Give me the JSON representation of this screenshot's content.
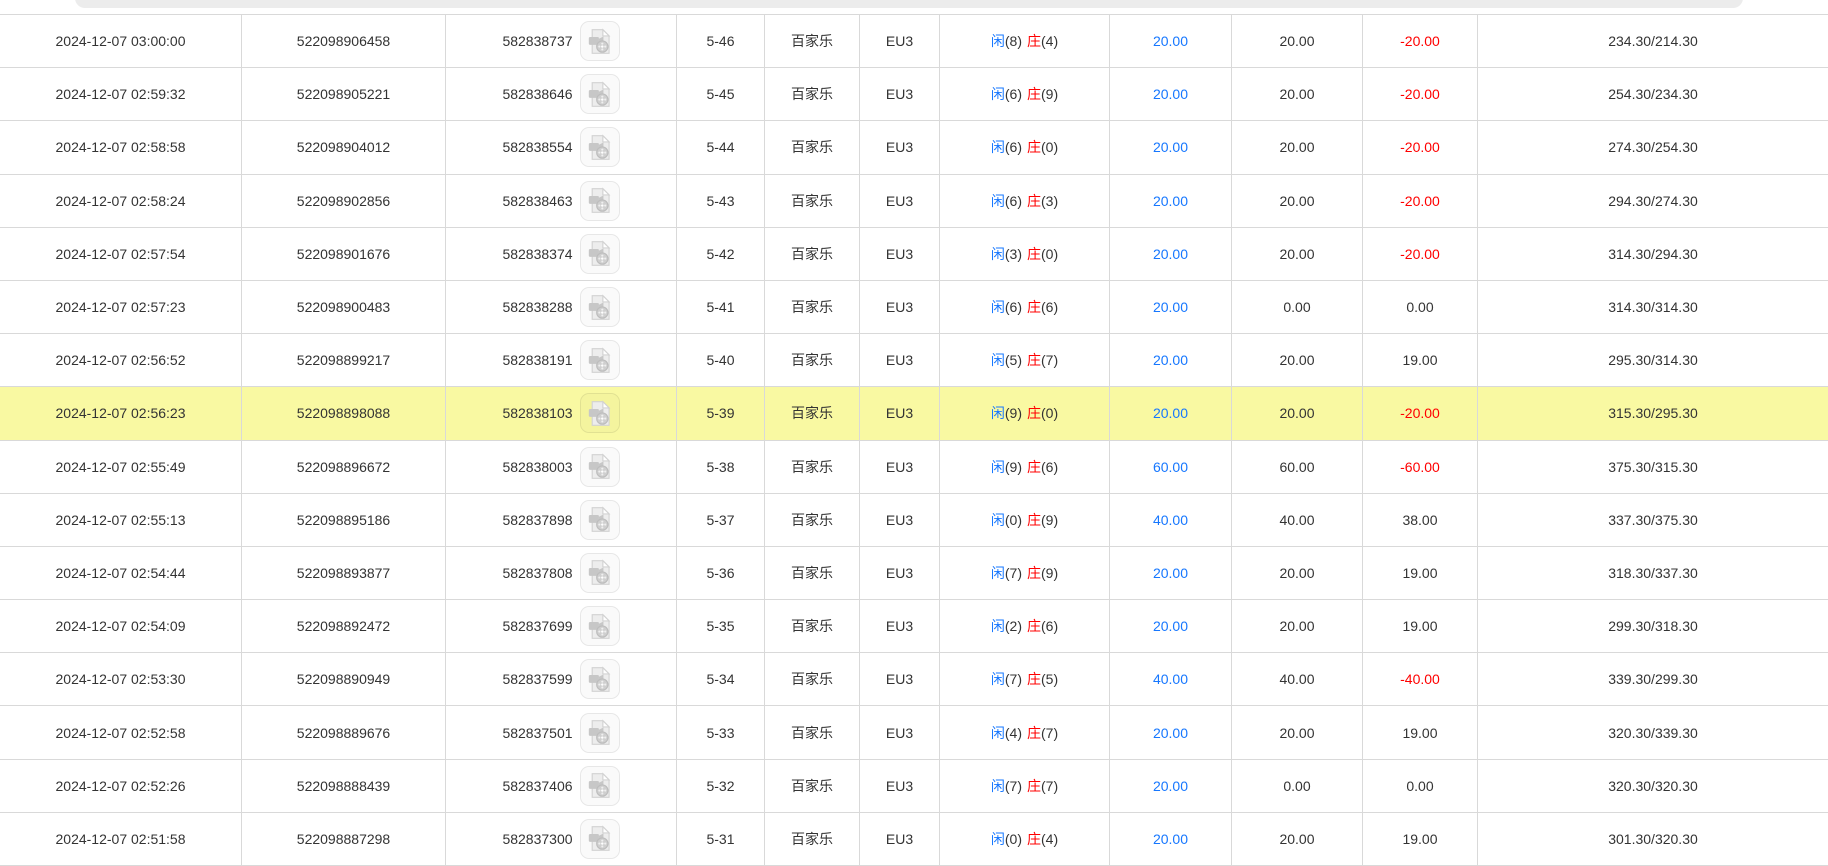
{
  "result_labels": {
    "player": "闲",
    "banker": "庄"
  },
  "colors": {
    "highlight": "#f9f9a2",
    "blue": "#1677ff",
    "red": "#ff0000",
    "text": "#333333",
    "border": "#d9d9d9"
  },
  "icons": {
    "video_replay": "video-file-icon"
  },
  "rows": [
    {
      "time": "2024-12-07 03:00:00",
      "order_id": "522098906458",
      "game_id": "582838737",
      "round": "5-46",
      "game_name": "百家乐",
      "table_name": "EU3",
      "player_score": "8",
      "banker_score": "4",
      "valid_bet": "20.00",
      "bet_amount": "20.00",
      "win_loss": "-20.00",
      "balance": "234.30/214.30",
      "highlight": false
    },
    {
      "time": "2024-12-07 02:59:32",
      "order_id": "522098905221",
      "game_id": "582838646",
      "round": "5-45",
      "game_name": "百家乐",
      "table_name": "EU3",
      "player_score": "6",
      "banker_score": "9",
      "valid_bet": "20.00",
      "bet_amount": "20.00",
      "win_loss": "-20.00",
      "balance": "254.30/234.30",
      "highlight": false
    },
    {
      "time": "2024-12-07 02:58:58",
      "order_id": "522098904012",
      "game_id": "582838554",
      "round": "5-44",
      "game_name": "百家乐",
      "table_name": "EU3",
      "player_score": "6",
      "banker_score": "0",
      "valid_bet": "20.00",
      "bet_amount": "20.00",
      "win_loss": "-20.00",
      "balance": "274.30/254.30",
      "highlight": false
    },
    {
      "time": "2024-12-07 02:58:24",
      "order_id": "522098902856",
      "game_id": "582838463",
      "round": "5-43",
      "game_name": "百家乐",
      "table_name": "EU3",
      "player_score": "6",
      "banker_score": "3",
      "valid_bet": "20.00",
      "bet_amount": "20.00",
      "win_loss": "-20.00",
      "balance": "294.30/274.30",
      "highlight": false
    },
    {
      "time": "2024-12-07 02:57:54",
      "order_id": "522098901676",
      "game_id": "582838374",
      "round": "5-42",
      "game_name": "百家乐",
      "table_name": "EU3",
      "player_score": "3",
      "banker_score": "0",
      "valid_bet": "20.00",
      "bet_amount": "20.00",
      "win_loss": "-20.00",
      "balance": "314.30/294.30",
      "highlight": false
    },
    {
      "time": "2024-12-07 02:57:23",
      "order_id": "522098900483",
      "game_id": "582838288",
      "round": "5-41",
      "game_name": "百家乐",
      "table_name": "EU3",
      "player_score": "6",
      "banker_score": "6",
      "valid_bet": "20.00",
      "bet_amount": "0.00",
      "win_loss": "0.00",
      "balance": "314.30/314.30",
      "highlight": false
    },
    {
      "time": "2024-12-07 02:56:52",
      "order_id": "522098899217",
      "game_id": "582838191",
      "round": "5-40",
      "game_name": "百家乐",
      "table_name": "EU3",
      "player_score": "5",
      "banker_score": "7",
      "valid_bet": "20.00",
      "bet_amount": "20.00",
      "win_loss": "19.00",
      "balance": "295.30/314.30",
      "highlight": false
    },
    {
      "time": "2024-12-07 02:56:23",
      "order_id": "522098898088",
      "game_id": "582838103",
      "round": "5-39",
      "game_name": "百家乐",
      "table_name": "EU3",
      "player_score": "9",
      "banker_score": "0",
      "valid_bet": "20.00",
      "bet_amount": "20.00",
      "win_loss": "-20.00",
      "balance": "315.30/295.30",
      "highlight": true
    },
    {
      "time": "2024-12-07 02:55:49",
      "order_id": "522098896672",
      "game_id": "582838003",
      "round": "5-38",
      "game_name": "百家乐",
      "table_name": "EU3",
      "player_score": "9",
      "banker_score": "6",
      "valid_bet": "60.00",
      "bet_amount": "60.00",
      "win_loss": "-60.00",
      "balance": "375.30/315.30",
      "highlight": false
    },
    {
      "time": "2024-12-07 02:55:13",
      "order_id": "522098895186",
      "game_id": "582837898",
      "round": "5-37",
      "game_name": "百家乐",
      "table_name": "EU3",
      "player_score": "0",
      "banker_score": "9",
      "valid_bet": "40.00",
      "bet_amount": "40.00",
      "win_loss": "38.00",
      "balance": "337.30/375.30",
      "highlight": false
    },
    {
      "time": "2024-12-07 02:54:44",
      "order_id": "522098893877",
      "game_id": "582837808",
      "round": "5-36",
      "game_name": "百家乐",
      "table_name": "EU3",
      "player_score": "7",
      "banker_score": "9",
      "valid_bet": "20.00",
      "bet_amount": "20.00",
      "win_loss": "19.00",
      "balance": "318.30/337.30",
      "highlight": false
    },
    {
      "time": "2024-12-07 02:54:09",
      "order_id": "522098892472",
      "game_id": "582837699",
      "round": "5-35",
      "game_name": "百家乐",
      "table_name": "EU3",
      "player_score": "2",
      "banker_score": "6",
      "valid_bet": "20.00",
      "bet_amount": "20.00",
      "win_loss": "19.00",
      "balance": "299.30/318.30",
      "highlight": false
    },
    {
      "time": "2024-12-07 02:53:30",
      "order_id": "522098890949",
      "game_id": "582837599",
      "round": "5-34",
      "game_name": "百家乐",
      "table_name": "EU3",
      "player_score": "7",
      "banker_score": "5",
      "valid_bet": "40.00",
      "bet_amount": "40.00",
      "win_loss": "-40.00",
      "balance": "339.30/299.30",
      "highlight": false
    },
    {
      "time": "2024-12-07 02:52:58",
      "order_id": "522098889676",
      "game_id": "582837501",
      "round": "5-33",
      "game_name": "百家乐",
      "table_name": "EU3",
      "player_score": "4",
      "banker_score": "7",
      "valid_bet": "20.00",
      "bet_amount": "20.00",
      "win_loss": "19.00",
      "balance": "320.30/339.30",
      "highlight": false
    },
    {
      "time": "2024-12-07 02:52:26",
      "order_id": "522098888439",
      "game_id": "582837406",
      "round": "5-32",
      "game_name": "百家乐",
      "table_name": "EU3",
      "player_score": "7",
      "banker_score": "7",
      "valid_bet": "20.00",
      "bet_amount": "0.00",
      "win_loss": "0.00",
      "balance": "320.30/320.30",
      "highlight": false
    },
    {
      "time": "2024-12-07 02:51:58",
      "order_id": "522098887298",
      "game_id": "582837300",
      "round": "5-31",
      "game_name": "百家乐",
      "table_name": "EU3",
      "player_score": "0",
      "banker_score": "4",
      "valid_bet": "20.00",
      "bet_amount": "20.00",
      "win_loss": "19.00",
      "balance": "301.30/320.30",
      "highlight": false
    }
  ]
}
